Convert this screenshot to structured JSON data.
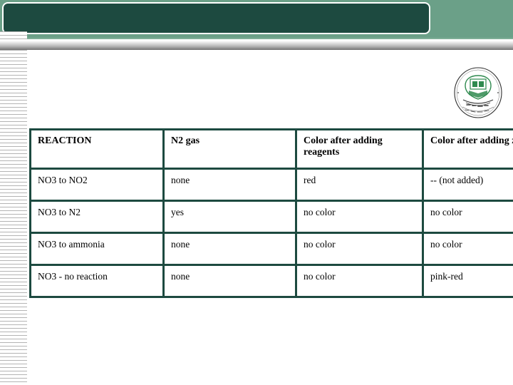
{
  "slide": {
    "title": "",
    "emblem": {
      "name": "islamic-university-seal",
      "ring_text_english": "Gaza Islamic University",
      "center_motif": "open-book-and-crescent"
    }
  },
  "colors": {
    "band_dark_green": "#1d4a40",
    "band_light_green": "#6ba088",
    "table_border": "#1d4a40",
    "stripe_gray": "#b4b4b4",
    "text": "#000000",
    "page_background": "#ffffff"
  },
  "table": {
    "name": "nitrate-reaction-results-table",
    "columns": [
      "REACTION",
      "N2 gas",
      "Color after adding reagents",
      "Color after adding zinc"
    ],
    "rows": [
      {
        "reaction": "NO3 to NO2",
        "n2_gas": "none",
        "color_after_reagents": "red",
        "color_after_zinc": "-- (not added)"
      },
      {
        "reaction": "NO3 to N2",
        "n2_gas": "yes",
        "color_after_reagents": "no color",
        "color_after_zinc": "no color"
      },
      {
        "reaction": "NO3 to ammonia",
        "n2_gas": "none",
        "color_after_reagents": "no color",
        "color_after_zinc": "no color"
      },
      {
        "reaction": "NO3 - no reaction",
        "n2_gas": "none",
        "color_after_reagents": "no color",
        "color_after_zinc": "pink-red"
      }
    ]
  }
}
